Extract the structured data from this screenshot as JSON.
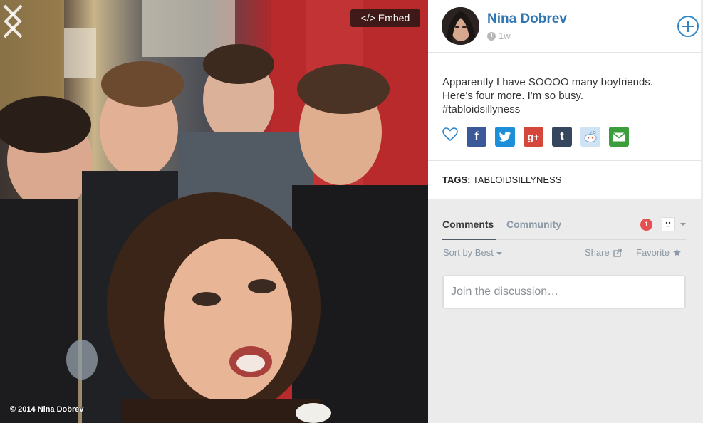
{
  "photo": {
    "embed_label": "</> Embed",
    "copyright": "© 2014 Nina Dobrev",
    "prev_icon": "chevron-left-icon",
    "next_icon": "chevron-right-icon"
  },
  "post": {
    "author": "Nina Dobrev",
    "time": "1w",
    "caption_lines": [
      "Apparently I have SOOOO many boyfriends.",
      "Here's four more. I'm so busy.",
      "#tabloidsillyness"
    ],
    "tags_label": "TAGS:",
    "tags_value": "TABLOIDSILLYNESS"
  },
  "share_buttons": [
    {
      "name": "facebook",
      "glyph": "f",
      "color": "#3b5998"
    },
    {
      "name": "twitter",
      "glyph": "t",
      "color": "#1d8fd8"
    },
    {
      "name": "google-plus",
      "glyph": "g+",
      "color": "#d6473b"
    },
    {
      "name": "tumblr",
      "glyph": "t",
      "color": "#36465d"
    },
    {
      "name": "reddit",
      "glyph": "r",
      "color": "#cfe3f5"
    },
    {
      "name": "email",
      "glyph": "✉",
      "color": "#3b9d3b"
    }
  ],
  "comments": {
    "tab_comments": "Comments",
    "tab_community": "Community",
    "notification_count": "1",
    "sort_label": "Sort by Best",
    "share_label": "Share",
    "favorite_label": "Favorite",
    "join_placeholder": "Join the discussion…"
  },
  "colors": {
    "author": "#2f76b3",
    "accent_blue": "#2e86c9",
    "notif_red": "#e85050"
  }
}
